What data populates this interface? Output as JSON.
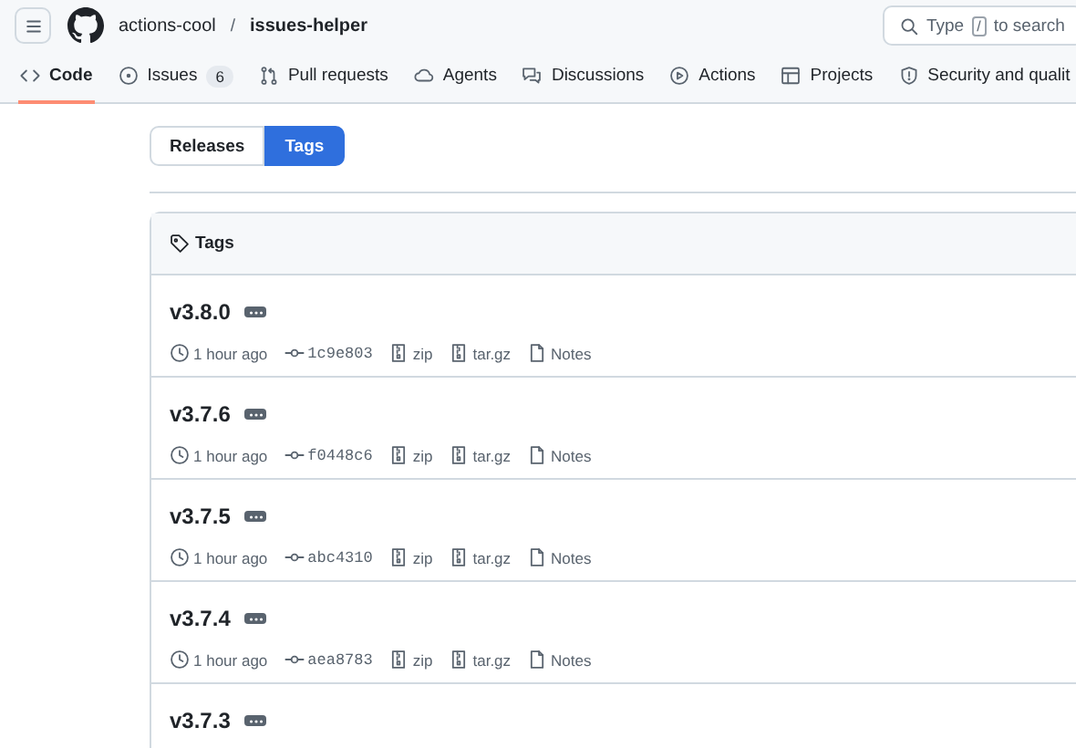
{
  "header": {
    "owner": "actions-cool",
    "separator": "/",
    "repo": "issues-helper",
    "search": {
      "before": "Type",
      "key": "/",
      "after": "to search"
    }
  },
  "nav": [
    {
      "label": "Code",
      "kind": "code",
      "selected": true
    },
    {
      "label": "Issues",
      "kind": "issue",
      "count": "6",
      "selected": false
    },
    {
      "label": "Pull requests",
      "kind": "pr",
      "selected": false
    },
    {
      "label": "Agents",
      "kind": "agent",
      "selected": false
    },
    {
      "label": "Discussions",
      "kind": "discuss",
      "selected": false
    },
    {
      "label": "Actions",
      "kind": "play",
      "selected": false
    },
    {
      "label": "Projects",
      "kind": "table",
      "selected": false
    },
    {
      "label": "Security and qualit",
      "kind": "shield",
      "selected": false
    }
  ],
  "switcher": [
    {
      "label": "Releases",
      "selected": false
    },
    {
      "label": "Tags",
      "selected": true
    }
  ],
  "box_title": "Tags",
  "tags": [
    {
      "name": "v3.8.0",
      "time": "1 hour ago",
      "commit": "1c9e803",
      "zip": "zip",
      "tar": "tar.gz",
      "notes": "Notes"
    },
    {
      "name": "v3.7.6",
      "time": "1 hour ago",
      "commit": "f0448c6",
      "zip": "zip",
      "tar": "tar.gz",
      "notes": "Notes"
    },
    {
      "name": "v3.7.5",
      "time": "1 hour ago",
      "commit": "abc4310",
      "zip": "zip",
      "tar": "tar.gz",
      "notes": "Notes"
    },
    {
      "name": "v3.7.4",
      "time": "1 hour ago",
      "commit": "aea8783",
      "zip": "zip",
      "tar": "tar.gz",
      "notes": "Notes"
    },
    {
      "name": "v3.7.3"
    }
  ]
}
